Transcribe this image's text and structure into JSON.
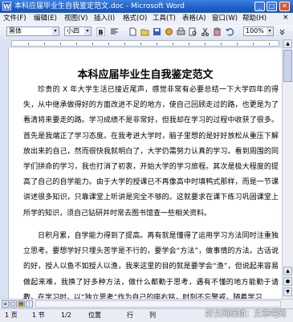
{
  "window": {
    "title": "本科应届毕业生自我鉴定范文.doc - Microsoft Word",
    "app_icon_letter": "W",
    "min_glyph": "_",
    "max_glyph": "□",
    "close_glyph": "✕"
  },
  "menu": {
    "items": [
      "文件(F)",
      "编辑(E)",
      "视图(V)",
      "插入(I)",
      "格式(O)",
      "工具(T)",
      "表格(A)",
      "窗口(W)",
      "帮助(H)"
    ],
    "doc_close": "×"
  },
  "toolbar": {
    "style_value": "黑体",
    "size_value": "小四",
    "bold": "B",
    "zoom_value": "100%",
    "dropdown_arrow": "▾"
  },
  "document": {
    "title": "本科应届毕业生自我鉴定范文",
    "paragraphs": [
      "珍贵的 X 年大学生活已接近尾声，感觉非常有必要总结一下大学四年的得失，从中继承做得好的方面改进不足的地方，使自己回顾走过的路，也更是为了看清将来要走的路。学习成绩不是非常好，但我却在学习的过程中收获了很多。首先是我端正了学习态度。在我考进大学时，脑子里想的是好好放松从重压下解放出来的自己，然而很快我就明白了，大学仍需努力认真的学习。看到周围的同学们拼命的学习，我也打消了初衷，开始大学的学习旅程。其次是极大程度的提高了自己的自学能力。由于大学的授课已不再像高中时填鸭式那样，而是一节课讲述很多知识，只靠课堂上听讲是完全不够的。这就要求在课下练习巩固课堂上所学的知识，须自己钻研并时常去图书馆查一些相关资料。",
      "日积月累，自学能力得到了提高。再有就是懂得了运用学习方法同时注重独立思考。要想学好只埋头苦学是不行的，要学会“方法”，做事情的方法。古话说的好，授人以鱼不如授人以渔，我来这里的目的就是要学会“渔”，但说起来容易做起来难，我换了好多种方法，做什么都勤于思考，遇有不懂的地方能勤于请教。在学习时，以“独立思考”作为自己的座右铭，时刻不忘警戒。随着学习"
    ]
  },
  "statusbar": {
    "page": "1 页",
    "section": "1 节",
    "page_of": "1/2",
    "position": "位置",
    "line": "行",
    "column": "列"
  },
  "watermark": "好文网编辑：文章吧网"
}
